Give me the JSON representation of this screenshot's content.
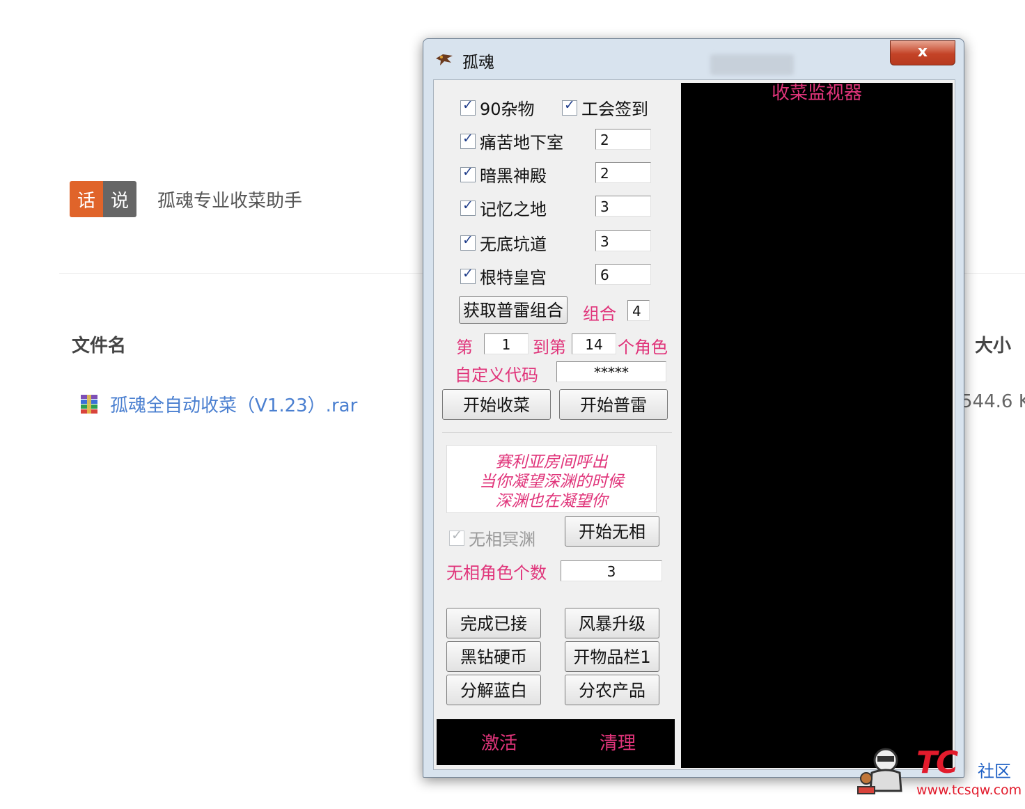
{
  "page": {
    "badge": {
      "left": "话",
      "right": "说"
    },
    "subtitle": "孤魂专业收菜助手",
    "columns": {
      "name": "文件名",
      "size": "大小"
    },
    "file": {
      "name": "孤魂全自动收菜（V1.23）.rar",
      "size": "544.6 K"
    }
  },
  "window": {
    "title": "孤魂",
    "close_label": "x",
    "monitor_title": "收菜监视器",
    "options": [
      {
        "label": "90杂物",
        "checked": true
      },
      {
        "label": "工会签到",
        "checked": true
      },
      {
        "label": "痛苦地下室",
        "checked": true,
        "value": "2"
      },
      {
        "label": "暗黑神殿",
        "checked": true,
        "value": "2"
      },
      {
        "label": "记忆之地",
        "checked": true,
        "value": "3"
      },
      {
        "label": "无底坑道",
        "checked": true,
        "value": "3"
      },
      {
        "label": "根特皇宫",
        "checked": true,
        "value": "6"
      }
    ],
    "get_combo_button": "获取普雷组合",
    "combo_label": "组合",
    "combo_value": "4",
    "range": {
      "from_label": "第",
      "from": "1",
      "to_label": "到第",
      "to": "14",
      "suffix": "个角色"
    },
    "custom_code_label": "自定义代码",
    "custom_code_value": "*****",
    "start_harvest_button": "开始收菜",
    "start_prey_button": "开始普雷",
    "quote": [
      "赛利亚房间呼出",
      "当你凝望深渊的时候",
      "深渊也在凝望你"
    ],
    "wuxiang_label": "无相冥渊",
    "wuxiang_checked": true,
    "start_wuxiang_button": "开始无相",
    "wuxiang_count_label": "无相角色个数",
    "wuxiang_count_value": "3",
    "action_buttons": [
      "完成已接",
      "风暴升级",
      "黑钻硬币",
      "开物品栏1",
      "分解蓝白",
      "分农产品"
    ],
    "activate_label": "激活",
    "clear_label": "清理"
  },
  "watermark": {
    "logo": "TC",
    "community": "社区",
    "url": "www.tcsqw.com"
  },
  "colors": {
    "accent_pink": "#e0347a",
    "badge_orange": "#e0642a",
    "link_blue": "#4a7fd0",
    "monitor_bg": "#000000"
  }
}
